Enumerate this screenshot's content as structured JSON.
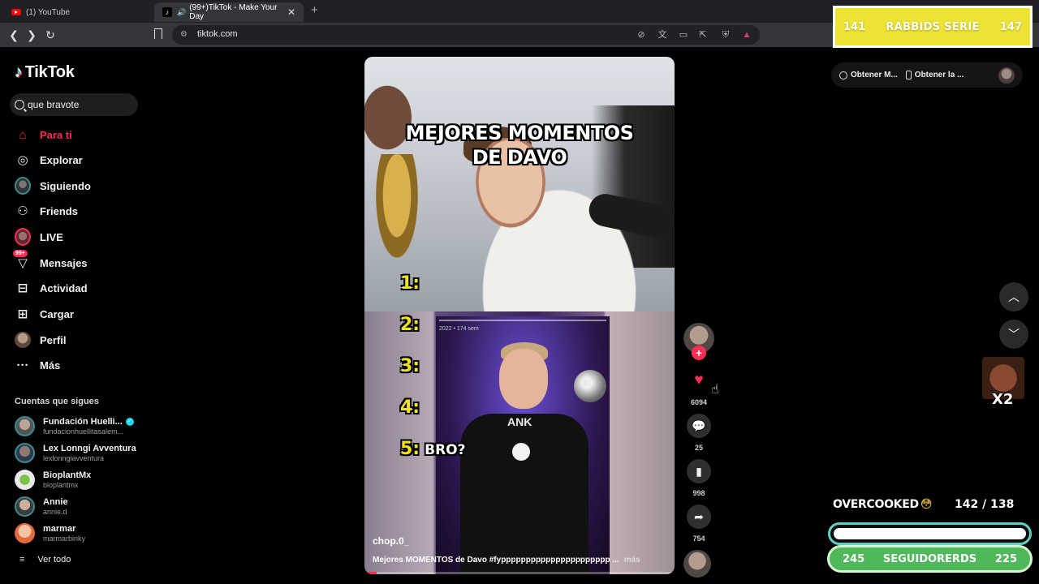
{
  "browser": {
    "tabs": [
      {
        "title": "(1) YouTube",
        "active": false
      },
      {
        "title": "(99+)TikTok - Make Your Day",
        "active": true
      }
    ],
    "url": "tiktok.com"
  },
  "sidebar": {
    "brand": "TikTok",
    "search_query": "que bravote",
    "nav": [
      {
        "label": "Para ti",
        "icon": "home-icon",
        "active": true
      },
      {
        "label": "Explorar",
        "icon": "compass-icon"
      },
      {
        "label": "Siguiendo",
        "icon": "following-avatar"
      },
      {
        "label": "Friends",
        "icon": "friends-icon"
      },
      {
        "label": "LIVE",
        "icon": "live-avatar"
      },
      {
        "label": "Mensajes",
        "icon": "messages-icon",
        "badge": "99+"
      },
      {
        "label": "Actividad",
        "icon": "activity-icon"
      },
      {
        "label": "Cargar",
        "icon": "upload-icon"
      },
      {
        "label": "Perfil",
        "icon": "profile-avatar"
      },
      {
        "label": "Más",
        "icon": "more-icon"
      }
    ],
    "following_title": "Cuentas que sigues",
    "accounts": [
      {
        "name": "Fundación Huelli...",
        "handle": "fundacionhuellitasalem...",
        "verified": true
      },
      {
        "name": "Lex Lonngi Avventura",
        "handle": "lexlonngiavventura"
      },
      {
        "name": "BioplantMx",
        "handle": "bioplantmx"
      },
      {
        "name": "Annie",
        "handle": "annie.d"
      },
      {
        "name": "marmar",
        "handle": "marmarbinky"
      }
    ],
    "see_all": "Ver todo"
  },
  "video": {
    "overlay_title_line1": "MEJORES MOMENTOS",
    "overlay_title_line2": "DE DAVO",
    "list": [
      "1:",
      "2:",
      "3:",
      "4:",
      "5:"
    ],
    "list_extra": "BRO?",
    "inner_text": "ANK",
    "inner_meta": "2022 • 174 sem",
    "author": "chop.0_",
    "description": "Mejores MOMENTOS de Davo #fypppppppppppppppppppppp ...",
    "more": "más",
    "progress": 0.04
  },
  "actions": {
    "likes": "6094",
    "comments": "25",
    "saves": "998",
    "shares": "754"
  },
  "right": {
    "get_desktop": "Obtener M...",
    "get_app": "Obtener la ..."
  },
  "stream": {
    "rabbids_left": "141",
    "rabbids_title": "RABBIDS SERIE",
    "rabbids_right": "147",
    "emote_label": "X2",
    "overcooked_label": "OVERCOOKED",
    "overcooked_emoji": "😳",
    "overcooked_count": "142 / 138",
    "overcooked_progress": 1.0,
    "followers_left": "245",
    "followers_label": "SEGUIDORERDS",
    "followers_right": "225"
  }
}
